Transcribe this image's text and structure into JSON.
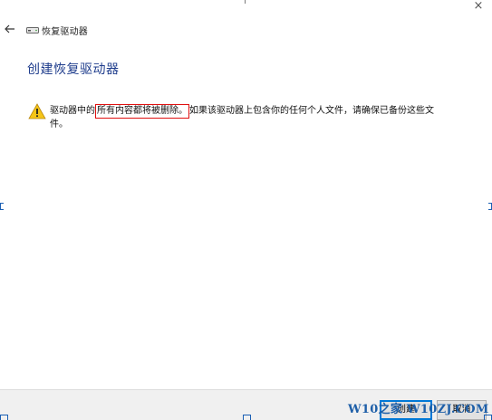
{
  "window": {
    "close_glyph": "×"
  },
  "nav": {
    "back_icon": "back-arrow-icon",
    "title": "恢复驱动器",
    "drive_icon": "drive-icon"
  },
  "page": {
    "heading": "创建恢复驱动器"
  },
  "warning": {
    "icon": "warning-icon",
    "text_before": "驱动器中的",
    "highlighted": "所有内容都将被删除。",
    "text_after": "如果该驱动器上包含你的任何个人文件，请确保已备份这些文件。"
  },
  "buttons": {
    "create": "创建",
    "cancel": "取消"
  },
  "watermark": {
    "text": "W10之家 W10ZJ.COM"
  },
  "colors": {
    "heading": "#1e3c8c",
    "highlight_border": "#e01010",
    "watermark": "#1e5fa8",
    "default_button_border": "#0078d7",
    "warning_yellow": "#f5c518"
  }
}
